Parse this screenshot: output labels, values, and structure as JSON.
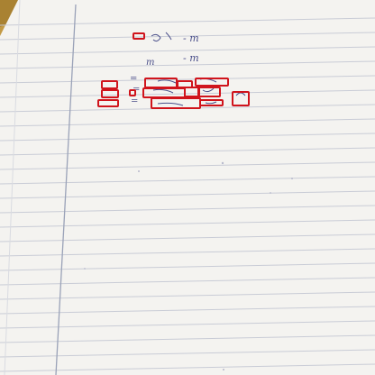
{
  "image": {
    "subject": "",
    "colors": {
      "paper": "#f4f3f0",
      "rule_line": "#c9ccd6",
      "margin_line": "#9aa2b8",
      "ink": "#4a4f8a",
      "box": "#d0141c",
      "background": "#caa24a"
    },
    "handwriting": {
      "line1": "- m",
      "line2": "- m",
      "line3": "m",
      "line4": "=",
      "line5": "=",
      "line6": "="
    }
  }
}
